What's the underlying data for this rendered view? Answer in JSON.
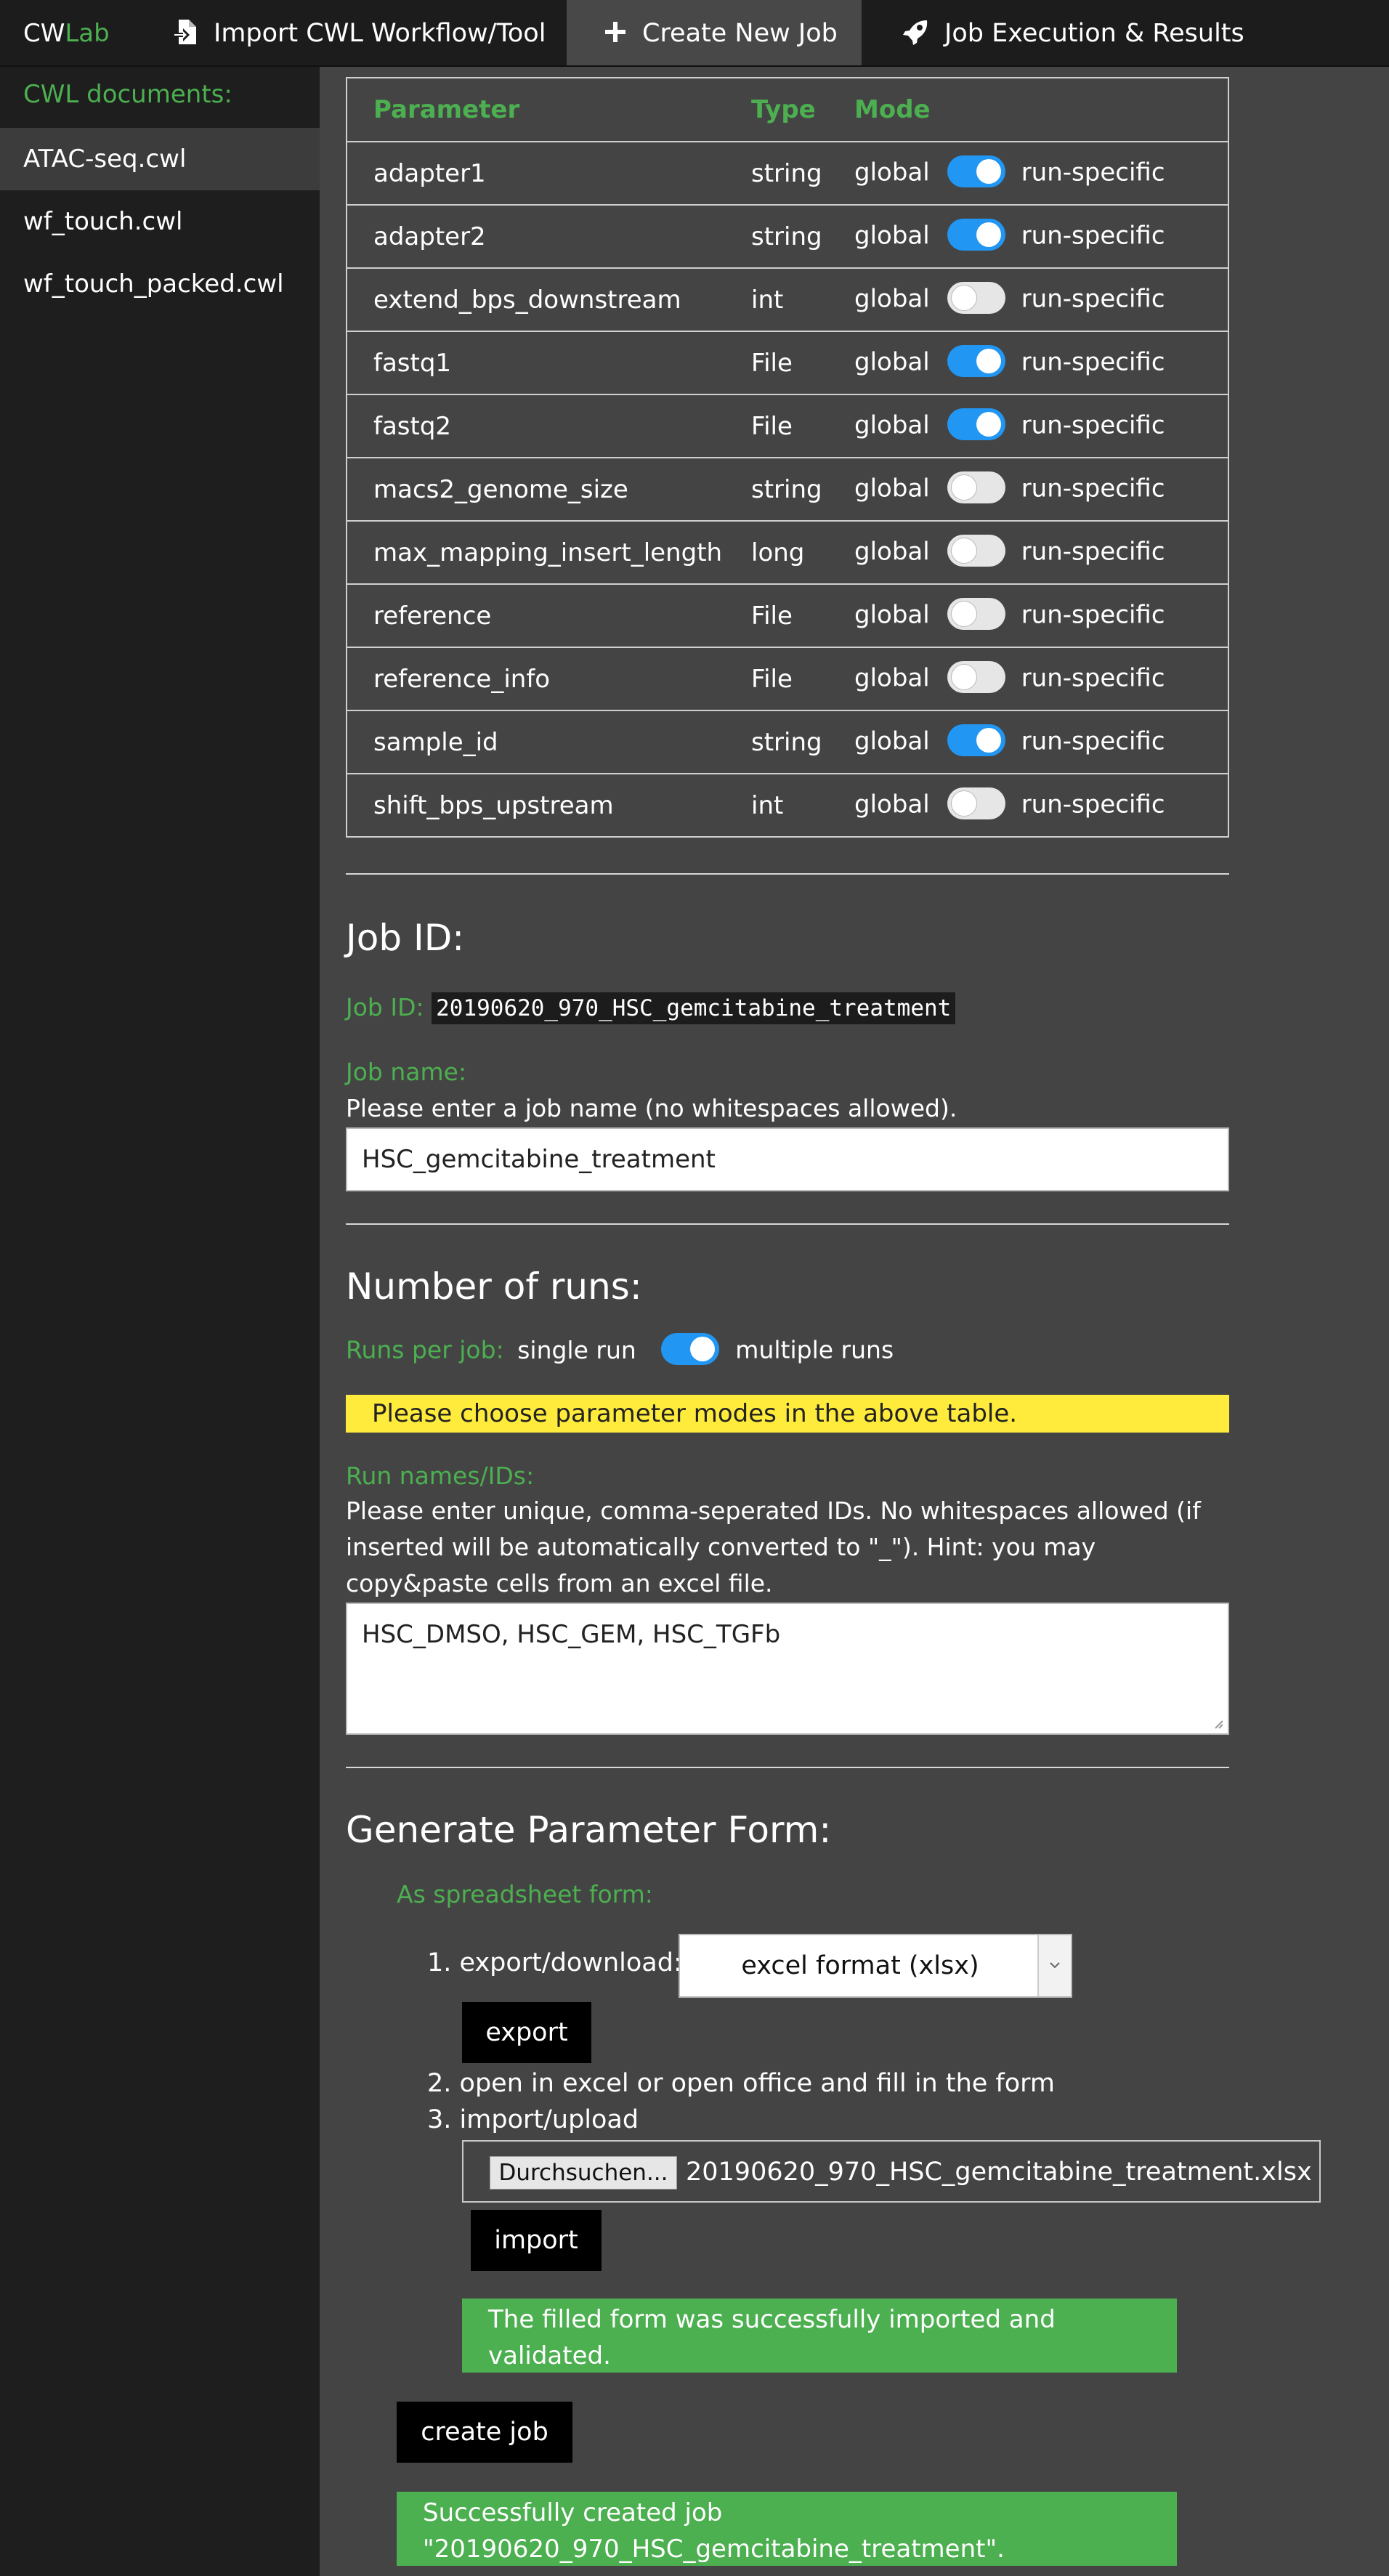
{
  "nav": {
    "brand_cw": "CW",
    "brand_lab": "Lab",
    "items": [
      {
        "label": "Import CWL Workflow/Tool",
        "icon": "file-import-icon"
      },
      {
        "label": "Create New Job",
        "icon": "plus-icon"
      },
      {
        "label": "Job Execution & Results",
        "icon": "rocket-icon"
      }
    ],
    "active_index": 1
  },
  "sidebar": {
    "title": "CWL documents:",
    "items": [
      "ATAC-seq.cwl",
      "wf_touch.cwl",
      "wf_touch_packed.cwl"
    ],
    "active_index": 0
  },
  "param_table": {
    "headers": [
      "Parameter",
      "Type",
      "Mode"
    ],
    "global_label": "global",
    "run_specific_label": "run-specific",
    "rows": [
      {
        "name": "adapter1",
        "type": "string",
        "run_specific": true
      },
      {
        "name": "adapter2",
        "type": "string",
        "run_specific": true
      },
      {
        "name": "extend_bps_downstream",
        "type": "int",
        "run_specific": false
      },
      {
        "name": "fastq1",
        "type": "File",
        "run_specific": true
      },
      {
        "name": "fastq2",
        "type": "File",
        "run_specific": true
      },
      {
        "name": "macs2_genome_size",
        "type": "string",
        "run_specific": false
      },
      {
        "name": "max_mapping_insert_length",
        "type": "long",
        "run_specific": false
      },
      {
        "name": "reference",
        "type": "File",
        "run_specific": false
      },
      {
        "name": "reference_info",
        "type": "File",
        "run_specific": false
      },
      {
        "name": "sample_id",
        "type": "string",
        "run_specific": true
      },
      {
        "name": "shift_bps_upstream",
        "type": "int",
        "run_specific": false
      }
    ]
  },
  "job_id_section": {
    "heading": "Job ID:",
    "job_id_label": "Job ID:",
    "job_id_value": "20190620_970_HSC_gemcitabine_treatment",
    "job_name_label": "Job name:",
    "job_name_hint": "Please enter a job name (no whitespaces allowed).",
    "job_name_value": "HSC_gemcitabine_treatment"
  },
  "runs_section": {
    "heading": "Number of runs:",
    "runs_per_job_label": "Runs per job:",
    "single_run_label": "single run",
    "multiple_runs_label": "multiple runs",
    "multiple_runs_enabled": true,
    "warning": "Please choose parameter modes in the above table.",
    "run_names_label": "Run names/IDs:",
    "run_names_hint_line1": "Please enter unique, comma-seperated IDs. No whitespaces allowed (if",
    "run_names_hint_line2": "inserted will be automatically converted to \"_\"). Hint: you may",
    "run_names_hint_line3": "copy&paste cells from an excel file.",
    "run_names_value": "HSC_DMSO, HSC_GEM, HSC_TGFb"
  },
  "generate_section": {
    "heading": "Generate Parameter Form:",
    "spreadsheet_label": "As spreadsheet form:",
    "step1_label": "export/download:",
    "format_selected": "excel format (xlsx)",
    "export_button": "export",
    "step2_label": "open in excel or open office and fill in the form",
    "step3_label": "import/upload",
    "browse_button": "Durchsuchen...",
    "file_name": "20190620_970_HSC_gemcitabine_treatment.xlsx",
    "import_button": "import",
    "import_success_line1": "The filled form was successfully imported and",
    "import_success_line2": "validated.",
    "create_job_button": "create job",
    "create_success_line1": "Successfully created job",
    "create_success_line2": "\"20190620_970_HSC_gemcitabine_treatment\"."
  },
  "colors": {
    "accent_green": "#4caf50",
    "toggle_on": "#2196f3",
    "warning_yellow": "#ffeb3b"
  }
}
